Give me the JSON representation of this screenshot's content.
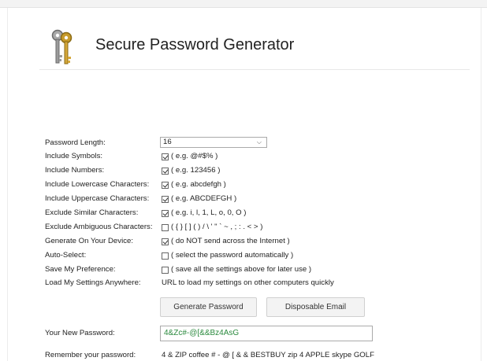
{
  "app": {
    "title": "Secure Password Generator"
  },
  "options": [
    {
      "label": "Password Length:",
      "type": "select",
      "value": "16"
    },
    {
      "label": "Include Symbols:",
      "type": "checkbox",
      "checked": true,
      "hint": "( e.g. @#$% )"
    },
    {
      "label": "Include Numbers:",
      "type": "checkbox",
      "checked": true,
      "hint": "( e.g. 123456 )"
    },
    {
      "label": "Include Lowercase Characters:",
      "type": "checkbox",
      "checked": true,
      "hint": "( e.g. abcdefgh )"
    },
    {
      "label": "Include Uppercase Characters:",
      "type": "checkbox",
      "checked": true,
      "hint": "( e.g. ABCDEFGH )"
    },
    {
      "label": "Exclude Similar Characters:",
      "type": "checkbox",
      "checked": true,
      "hint": "( e.g. i, l, 1, L, o, 0, O )"
    },
    {
      "label": "Exclude Ambiguous Characters:",
      "type": "checkbox",
      "checked": false,
      "hint": "( { } [ ] ( ) / \\ ' \" ` ~ , ; : . < > )"
    },
    {
      "label": "Generate On Your Device:",
      "type": "checkbox",
      "checked": true,
      "hint": "( do NOT send across the Internet )"
    },
    {
      "label": "Auto-Select:",
      "type": "checkbox",
      "checked": false,
      "hint": "( select the password automatically )"
    },
    {
      "label": "Save My Preference:",
      "type": "checkbox",
      "checked": false,
      "hint": "( save all the settings above for later use )"
    },
    {
      "label": "Load My Settings Anywhere:",
      "type": "text",
      "hint": "URL to load my settings on other computers quickly"
    }
  ],
  "buttons": {
    "generate": "Generate Password",
    "disposable": "Disposable Email"
  },
  "result": {
    "label": "Your New Password:",
    "password": "4&Zc#-@[&&Bz4AsG",
    "remember_label": "Remember your password:",
    "remember_text": "4 & ZIP coffee # - @ [ & & BESTBUY zip 4 APPLE skype GOLF"
  },
  "colors": {
    "password_text": "#2b8a3e"
  }
}
